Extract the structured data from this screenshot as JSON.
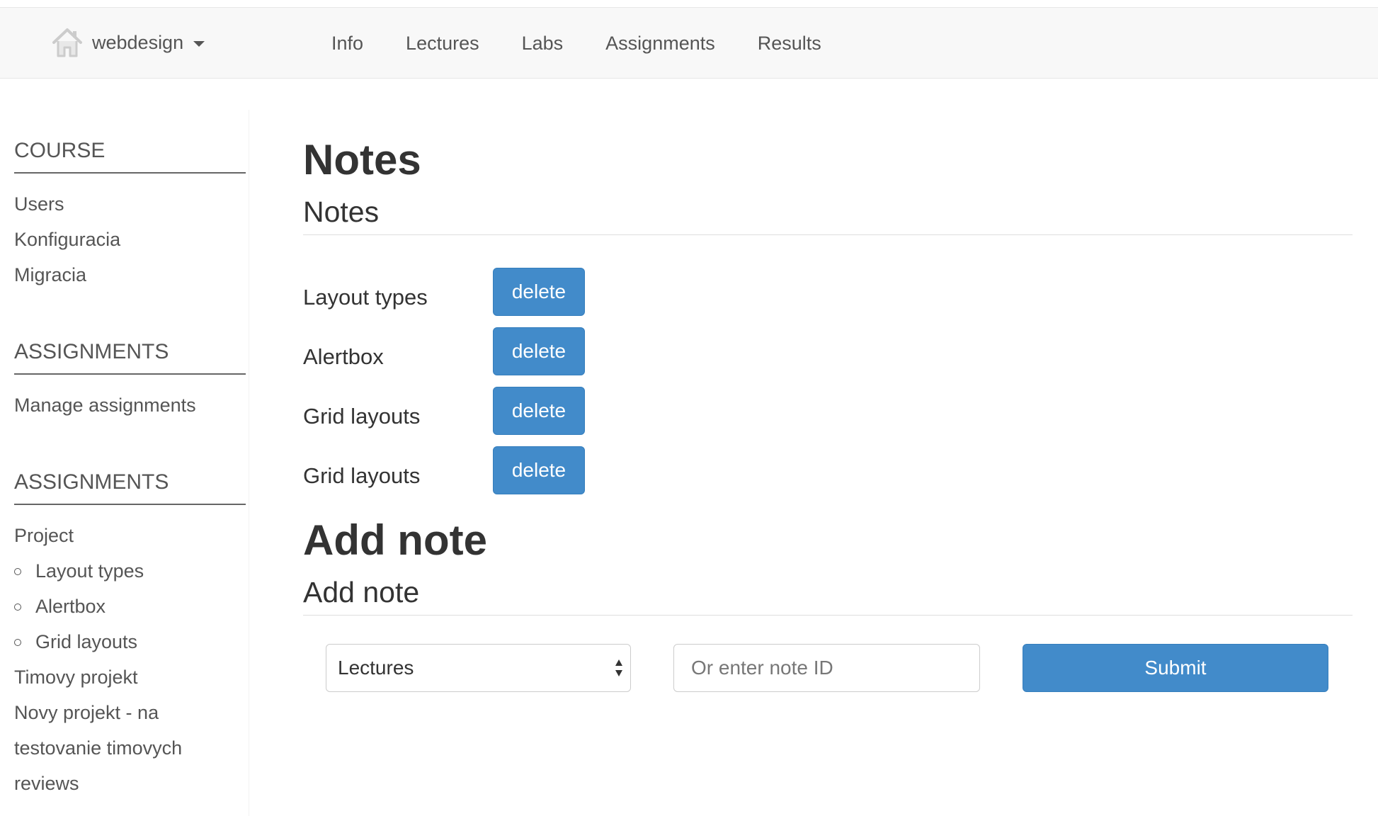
{
  "navbar": {
    "brand": {
      "label": "webdesign",
      "icon": "home-icon"
    },
    "links": [
      "Info",
      "Lectures",
      "Labs",
      "Assignments",
      "Results"
    ]
  },
  "sidebar": {
    "course": {
      "heading": "COURSE",
      "items": [
        "Users",
        "Konfiguracia",
        "Migracia"
      ]
    },
    "assignments_manage": {
      "heading": "ASSIGNMENTS",
      "items": [
        "Manage assignments"
      ]
    },
    "assignments_list": {
      "heading": "ASSIGNMENTS",
      "project": "Project",
      "project_subitems": [
        "Layout types",
        "Alertbox",
        "Grid layouts"
      ],
      "timovy": "Timovy projekt",
      "novy_line1": "Novy projekt - na",
      "novy_line2": "testovanie timovych",
      "novy_line3": "reviews"
    }
  },
  "main": {
    "notes_title": "Notes",
    "notes_subtitle": "Notes",
    "notes": [
      {
        "title": "Layout types",
        "action": "delete"
      },
      {
        "title": "Alertbox",
        "action": "delete"
      },
      {
        "title": "Grid layouts",
        "action": "delete"
      },
      {
        "title": "Grid layouts",
        "action": "delete"
      }
    ],
    "add_title": "Add note",
    "add_subtitle": "Add note",
    "form": {
      "select_value": "Lectures",
      "note_id_placeholder": "Or enter note ID",
      "submit_label": "Submit"
    }
  },
  "colors": {
    "primary": "#428bca",
    "navbar_bg": "#f8f8f8",
    "text": "#333333",
    "muted_text": "#555555"
  }
}
